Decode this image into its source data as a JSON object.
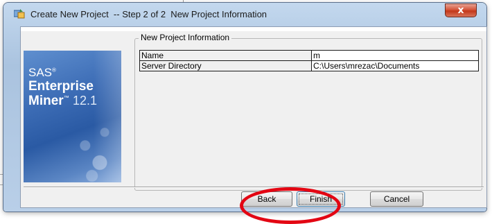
{
  "window": {
    "title": "Create New Project  -- Step 2 of 2  New Project Information",
    "close_glyph": "x"
  },
  "splash": {
    "brand": "SAS",
    "brand_mark": "®",
    "product_line1": "Enterprise",
    "product_line2": "Miner",
    "product_mark": "™",
    "version": "12.1"
  },
  "group": {
    "legend": "New Project Information",
    "rows": [
      {
        "key": "Name",
        "value": "m"
      },
      {
        "key": "Server Directory",
        "value": "C:\\Users\\mrezac\\Documents"
      }
    ]
  },
  "buttons": {
    "back": "Back",
    "finish": "Finish",
    "cancel": "Cancel"
  },
  "annotation": {
    "color": "#e30613"
  }
}
